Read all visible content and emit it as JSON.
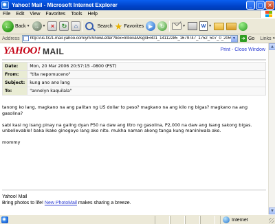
{
  "window": {
    "title": "Yahoo! Mail - Microsoft Internet Explorer",
    "controls": [
      "_",
      "□",
      "×"
    ]
  },
  "menu": {
    "items": [
      "File",
      "Edit",
      "View",
      "Favorites",
      "Tools",
      "Help"
    ]
  },
  "toolbar": {
    "back_label": "Back",
    "search_label": "Search",
    "favorites_label": "Favorites"
  },
  "address": {
    "label": "Address",
    "url": "http://us.f321.mail.yahoo.com/ym/ShowLetter?box=Inbox&MsgId=801_14112285_1679747_1752_507_0_20596_1330_37(",
    "go_label": "Go",
    "links_label": "Links"
  },
  "page": {
    "logo_text": "YAHOO!",
    "logo_suffix": "MAIL",
    "print_label": "Print",
    "separator": "-",
    "close_label": "Close Window",
    "headers": [
      {
        "key": "Date:",
        "value": "Mon, 20 Mar 2006 20:57:15 -0800 (PST)"
      },
      {
        "key": "From:",
        "value": "\"tita nepomuceno\""
      },
      {
        "key": "Subject:",
        "value": "kung ano ano lang"
      },
      {
        "key": "To:",
        "value": "\"annelyn kaquilala\""
      }
    ],
    "body": [
      "tanong ko lang, magkano na ang palitan ng US dollar to peso?  magkano na ang kilo ng bigas? magkano na ang gasolina?",
      "sabi kasi ng isang pinay na galing dyan P50 na daw ang litro ng gasolina, P2,000 na daw ang isang sakong bigas.  unbelievable! baka ikako ginogoyo lang ako nito.  mukha naman akong tanga kung maniniwala ako.",
      "mommy"
    ],
    "footer": {
      "line1": "Yahoo! Mail",
      "line2_prefix": "Bring photos to life!",
      "link": "New PhotoMail",
      "line2_suffix": "makes sharing a breeze."
    }
  },
  "status": {
    "zone": "Internet"
  }
}
